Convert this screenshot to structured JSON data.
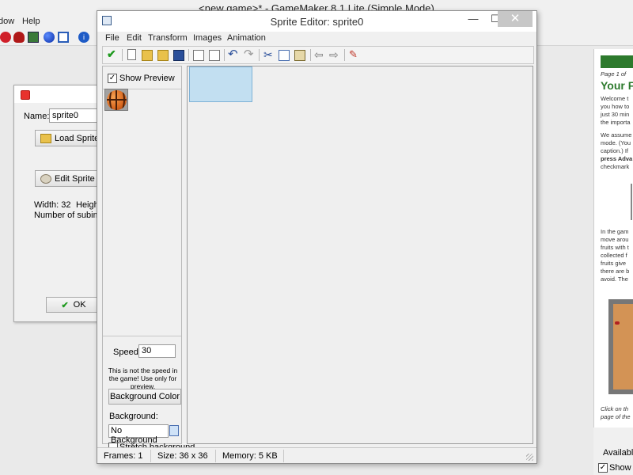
{
  "main_window": {
    "title": "<new game>* - GameMaker 8.1 Lite (Simple Mode)",
    "menu": [
      "dow",
      "Help"
    ]
  },
  "sprite_properties": {
    "name_label": "Name:",
    "name_value": "sprite0",
    "load_sprite": "Load Sprite",
    "edit_sprite": "Edit Sprite",
    "width_text": "Width: 32",
    "height_text": "Heigh",
    "subimages_text": "Number of subimage",
    "ok_label": "OK"
  },
  "sprite_editor": {
    "title": "Sprite Editor: sprite0",
    "menu": [
      "File",
      "Edit",
      "Transform",
      "Images",
      "Animation"
    ],
    "show_preview_label": "Show Preview",
    "show_preview_checked": true,
    "speed_label": "Speed:",
    "speed_value": "30",
    "speed_note": "This is not the speed in the game! Use only for preview.",
    "background_color_button": "Background Color",
    "background_label": "Background:",
    "background_value": "No Background",
    "stretch_background_label": "Stretch background",
    "stretch_background_checked": false,
    "status": {
      "frames": "Frames: 1",
      "size": "Size: 36 x 36",
      "memory": "Memory: 5 KB"
    }
  },
  "tutorial": {
    "page": "Page 1 of",
    "heading": "Your F",
    "para1": [
      "Welcome t",
      "you how to",
      "just 30 min",
      "the importa"
    ],
    "para2": [
      "We assume",
      "mode. (You",
      "caption.) If",
      "press Adva",
      "checkmark"
    ],
    "para3": [
      "In the gam",
      "move arou",
      "fruits with t",
      "collected f",
      "fruits give",
      "there are b",
      "avoid. The"
    ],
    "caption": [
      "Click on th",
      "page of the"
    ]
  },
  "bottom_right": {
    "available": "Available",
    "show_label": "Show th"
  },
  "colors": {
    "accent_green": "#2d7a2d",
    "frame_selection": "#c2dff1"
  }
}
